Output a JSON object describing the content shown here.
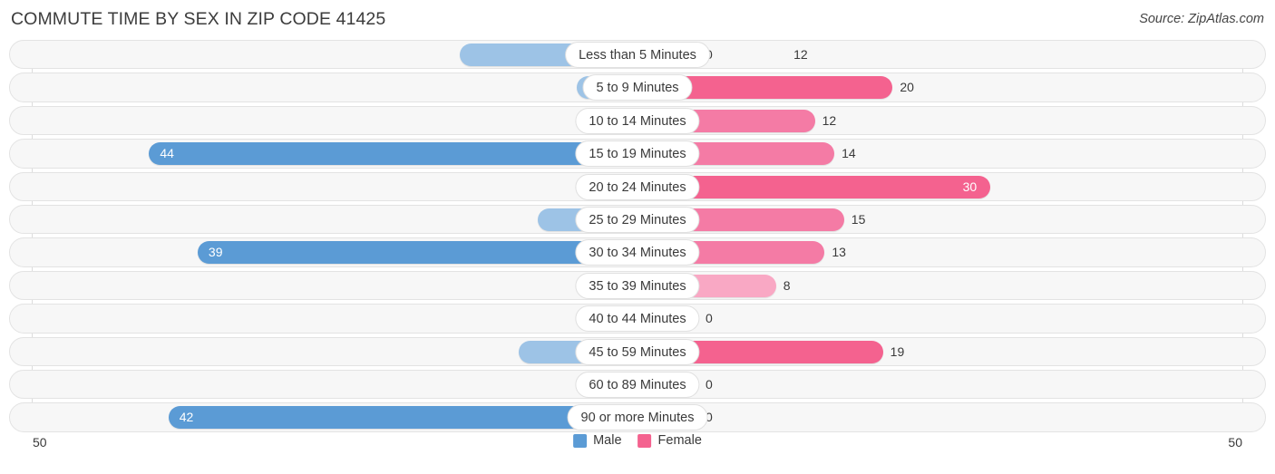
{
  "header": {
    "title": "COMMUTE TIME BY SEX IN ZIP CODE 41425",
    "source": "Source: ZipAtlas.com"
  },
  "legend": {
    "male_label": "Male",
    "female_label": "Female",
    "male_color": "#5b9bd5",
    "female_color": "#f4628f"
  },
  "axis": {
    "left_end": "50",
    "right_end": "50",
    "max": 50
  },
  "chart_data": {
    "type": "bar",
    "title": "COMMUTE TIME BY SEX IN ZIP CODE 41425",
    "orientation": "horizontal-diverging",
    "xlabel": "",
    "ylabel": "",
    "xlim": [
      50,
      50
    ],
    "grid": false,
    "legend_position": "bottom-center",
    "categories": [
      "Less than 5 Minutes",
      "5 to 9 Minutes",
      "10 to 14 Minutes",
      "15 to 19 Minutes",
      "20 to 24 Minutes",
      "25 to 29 Minutes",
      "30 to 34 Minutes",
      "35 to 39 Minutes",
      "40 to 44 Minutes",
      "45 to 59 Minutes",
      "60 to 89 Minutes",
      "90 or more Minutes"
    ],
    "series": [
      {
        "name": "Male",
        "color": "#5b9bd5",
        "values": [
          12,
          0,
          0,
          44,
          0,
          4,
          39,
          0,
          0,
          6,
          0,
          42
        ]
      },
      {
        "name": "Female",
        "color": "#f4628f",
        "values": [
          0,
          20,
          12,
          14,
          30,
          15,
          13,
          8,
          0,
          19,
          0,
          0
        ]
      }
    ]
  },
  "rows": [
    {
      "label": "Less than 5 Minutes",
      "male": {
        "value": "12",
        "inside": false,
        "tone": "light"
      },
      "female": {
        "value": "0",
        "inside": false,
        "tone": "light"
      }
    },
    {
      "label": "5 to 9 Minutes",
      "male": {
        "value": "0",
        "inside": false,
        "tone": "light"
      },
      "female": {
        "value": "20",
        "inside": false,
        "tone": "strong"
      }
    },
    {
      "label": "10 to 14 Minutes",
      "male": {
        "value": "0",
        "inside": false,
        "tone": "light"
      },
      "female": {
        "value": "12",
        "inside": false,
        "tone": "mid"
      }
    },
    {
      "label": "15 to 19 Minutes",
      "male": {
        "value": "44",
        "inside": true,
        "tone": "strong"
      },
      "female": {
        "value": "14",
        "inside": false,
        "tone": "mid"
      }
    },
    {
      "label": "20 to 24 Minutes",
      "male": {
        "value": "0",
        "inside": false,
        "tone": "light"
      },
      "female": {
        "value": "30",
        "inside": true,
        "tone": "strong"
      }
    },
    {
      "label": "25 to 29 Minutes",
      "male": {
        "value": "4",
        "inside": false,
        "tone": "light"
      },
      "female": {
        "value": "15",
        "inside": false,
        "tone": "mid"
      }
    },
    {
      "label": "30 to 34 Minutes",
      "male": {
        "value": "39",
        "inside": true,
        "tone": "strong"
      },
      "female": {
        "value": "13",
        "inside": false,
        "tone": "mid"
      }
    },
    {
      "label": "35 to 39 Minutes",
      "male": {
        "value": "0",
        "inside": false,
        "tone": "light"
      },
      "female": {
        "value": "8",
        "inside": false,
        "tone": "light"
      }
    },
    {
      "label": "40 to 44 Minutes",
      "male": {
        "value": "0",
        "inside": false,
        "tone": "light"
      },
      "female": {
        "value": "0",
        "inside": false,
        "tone": "light"
      }
    },
    {
      "label": "45 to 59 Minutes",
      "male": {
        "value": "6",
        "inside": false,
        "tone": "light"
      },
      "female": {
        "value": "19",
        "inside": false,
        "tone": "strong"
      }
    },
    {
      "label": "60 to 89 Minutes",
      "male": {
        "value": "0",
        "inside": false,
        "tone": "light"
      },
      "female": {
        "value": "0",
        "inside": false,
        "tone": "light"
      }
    },
    {
      "label": "90 or more Minutes",
      "male": {
        "value": "42",
        "inside": true,
        "tone": "strong"
      },
      "female": {
        "value": "0",
        "inside": false,
        "tone": "light"
      }
    }
  ]
}
